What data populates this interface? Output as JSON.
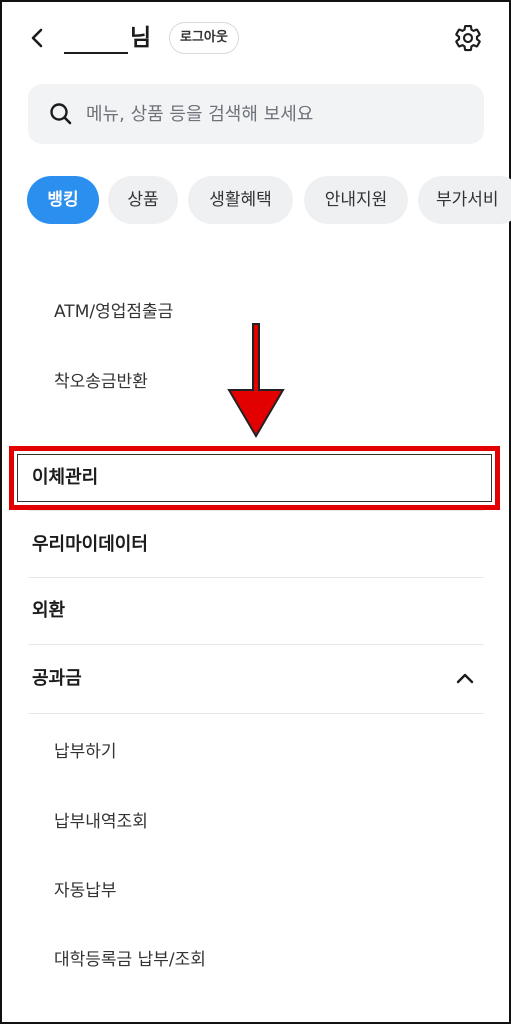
{
  "header": {
    "name_suffix": "님",
    "logout_label": "로그아웃"
  },
  "search": {
    "placeholder": "메뉴, 상품 등을 검색해 보세요"
  },
  "tabs": [
    {
      "label": "뱅킹",
      "active": true
    },
    {
      "label": "상품",
      "active": false
    },
    {
      "label": "생활혜택",
      "active": false
    },
    {
      "label": "안내지원",
      "active": false
    },
    {
      "label": "부가서비",
      "active": false
    }
  ],
  "menu": {
    "prev_subitems": [
      "ATM/영업점출금",
      "착오송금반환"
    ],
    "categories": [
      "이체관리",
      "우리마이데이터",
      "외환",
      "공과금"
    ],
    "utility_subitems": [
      "납부하기",
      "납부내역조회",
      "자동납부",
      "대학등록금 납부/조회"
    ]
  },
  "annotation": {
    "highlight_color": "#e30000"
  },
  "colors": {
    "accent": "#2b8ff0",
    "chip_bg": "#eef0f2",
    "search_bg": "#f2f3f5"
  },
  "icons": [
    "back-icon",
    "settings-icon",
    "search-icon",
    "chevron-up-icon",
    "down-arrow-icon"
  ]
}
